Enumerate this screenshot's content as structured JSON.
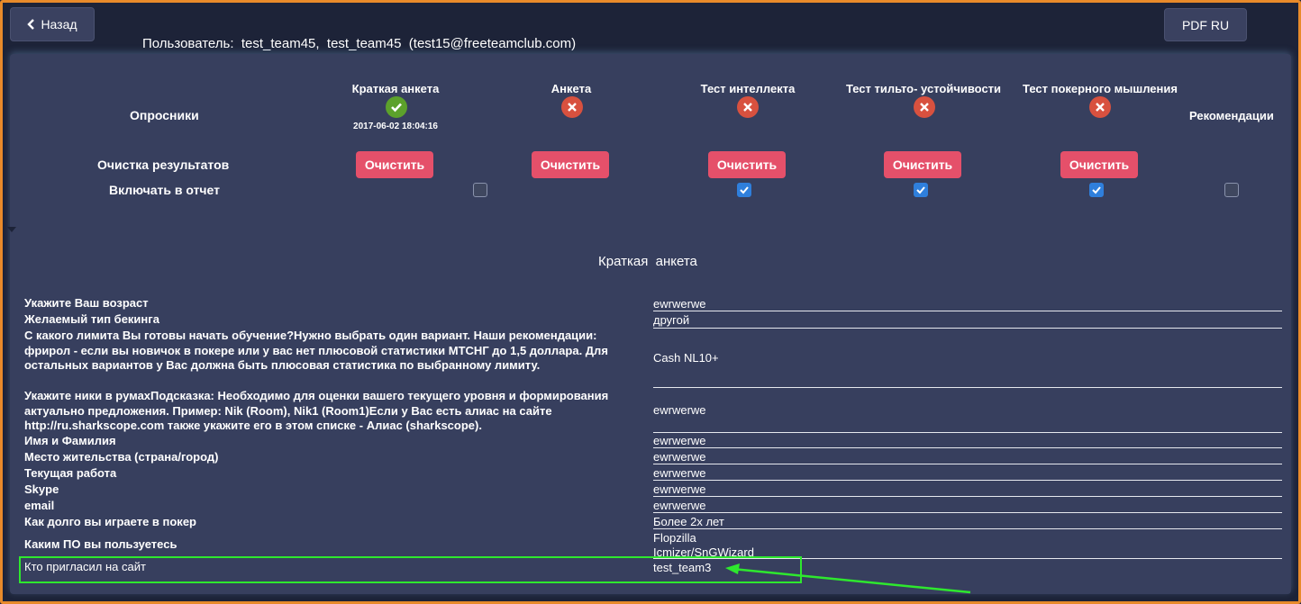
{
  "header": {
    "back_label": "Назад",
    "pdf_label": "PDF RU",
    "user_line": "Пользователь:  test_team45,  test_team45  (test15@freeteamclub.com)"
  },
  "surveys": {
    "row_label": "Опросники",
    "recommendations_label": "Рекомендации",
    "columns": [
      {
        "title": "Краткая анкета",
        "status": "done",
        "date": "2017-06-02 18:04:16",
        "include": false
      },
      {
        "title": "Анкета",
        "status": "missing",
        "include": true
      },
      {
        "title": "Тест интеллекта",
        "status": "missing",
        "include": true
      },
      {
        "title": "Тест тильто- устойчивости",
        "status": "missing",
        "include": true
      },
      {
        "title": "Тест покерного мышления",
        "status": "missing",
        "include": false
      }
    ],
    "clear_row_label": "Очистка результатов",
    "clear_button_label": "Очистить",
    "include_row_label": "Включать в отчет"
  },
  "section": {
    "title": "Краткая  анкета"
  },
  "answers": [
    {
      "q": "Укажите Ваш возраст",
      "a": "ewrwerwe"
    },
    {
      "q": "Желаемый тип бекинга",
      "a": "другой"
    },
    {
      "q": "С какого лимита Вы готовы начать обучение?Нужно выбрать один вариант. Наши рекомендации: фрирол - если вы новичок в покере или у вас нет плюсовой статистики МТСНГ до 1,5 доллара. Для остальных вариантов у Вас должна быть плюсовая статистика по выбранному лимиту.",
      "a": "Cash NL10+"
    },
    {
      "q": "Укажите ники в румахПодсказка: Необходимо для оценки вашего текущего уровня и формирования актуально предложения. Пример: Nik (Room), Nik1 (Room1)Если у Вас есть алиас на сайте http://ru.sharkscope.com также укажите его в этом списке - Алиас (sharkscope).",
      "a": "ewrwerwe"
    },
    {
      "q": "Имя и Фамилия",
      "a": "ewrwerwe"
    },
    {
      "q": "Место жительства (страна/город)",
      "a": "ewrwerwe"
    },
    {
      "q": "Текущая работа",
      "a": "ewrwerwe"
    },
    {
      "q": "Skype",
      "a": "ewrwerwe"
    },
    {
      "q": "email",
      "a": "ewrwerwe"
    },
    {
      "q": "Как долго вы играете в покер",
      "a": "Более 2х лет"
    },
    {
      "q": "Каким ПО вы пользуетесь",
      "a": "Flopzilla",
      "a2": "Icmizer/SnGWizard"
    },
    {
      "q": "Кто пригласил на сайт",
      "a": "test_team3"
    }
  ],
  "colors": {
    "accent_border": "#e88a2a",
    "panel": "#373f5e",
    "clear_button": "#e5506a",
    "ok": "#5ca12b",
    "missing": "#d8513f",
    "highlight": "#2ee82e"
  }
}
